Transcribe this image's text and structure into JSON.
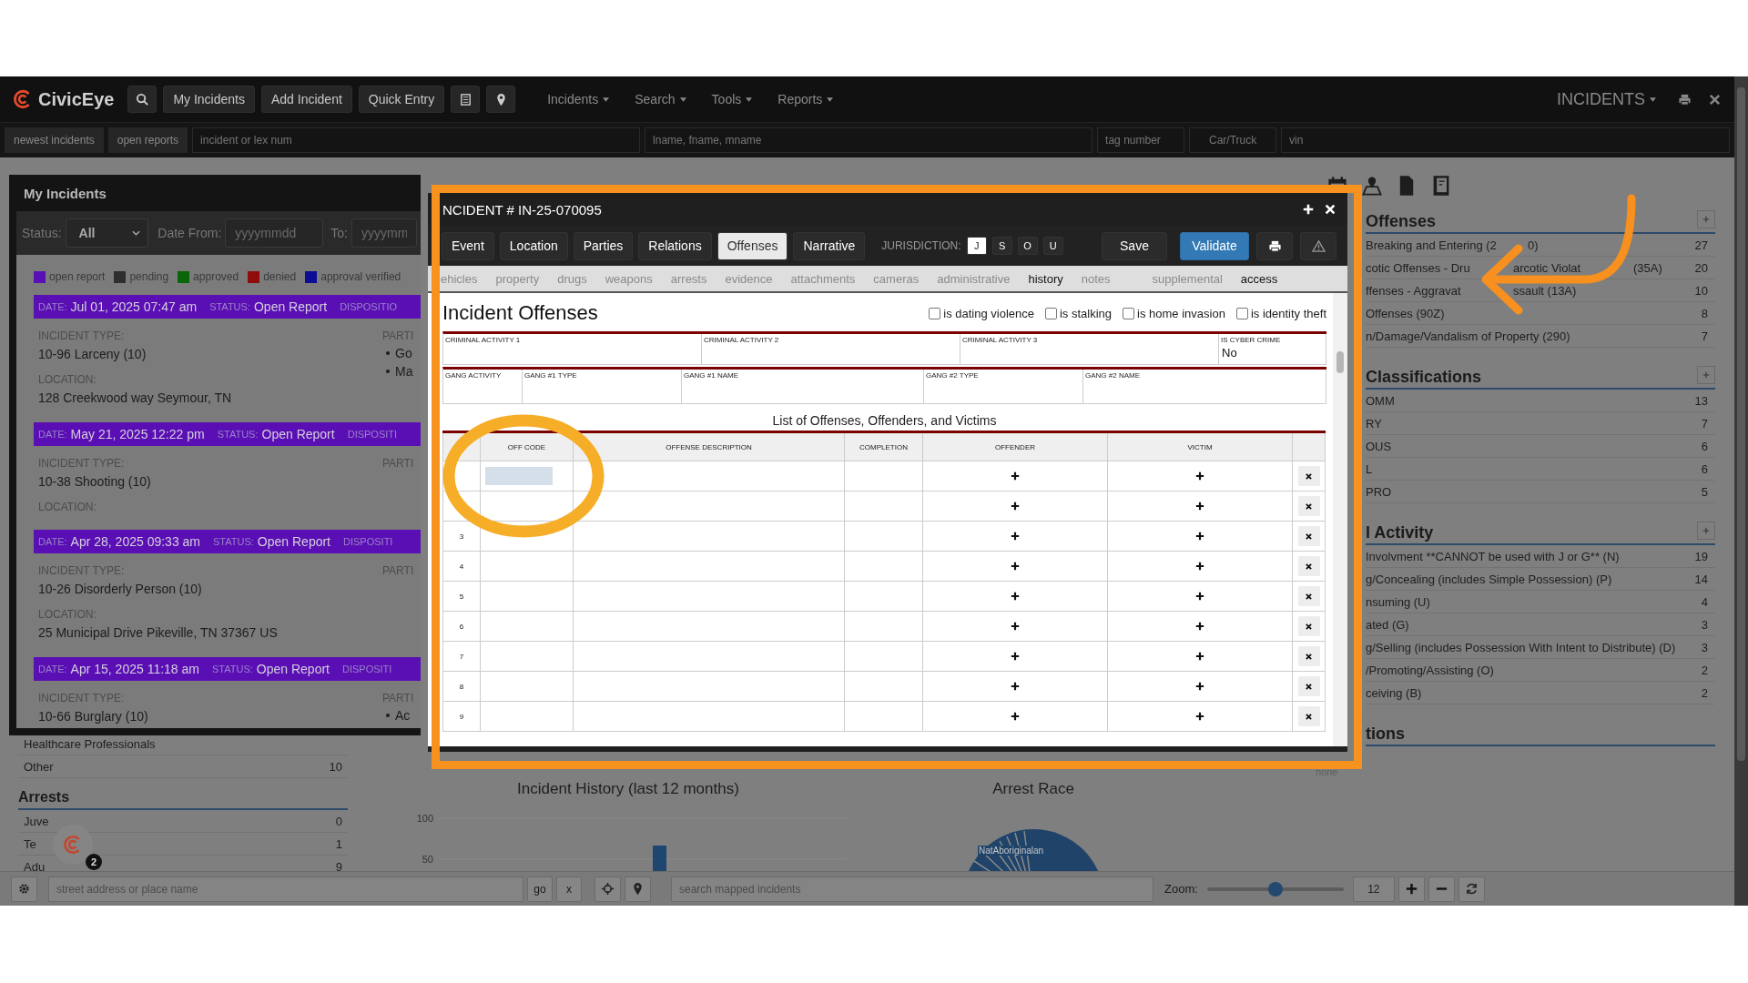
{
  "navbar": {
    "brand": "CivicEye",
    "buttons": [
      "My Incidents",
      "Add Incident",
      "Quick Entry"
    ],
    "menus": [
      "Incidents",
      "Search",
      "Tools",
      "Reports"
    ],
    "module": "INCIDENTS"
  },
  "quick_search": {
    "buttons": [
      "newest incidents",
      "open reports"
    ],
    "fields": [
      {
        "placeholder": "incident or lex num"
      },
      {
        "placeholder": "lname, fname, mname"
      },
      {
        "placeholder": "tag number"
      },
      {
        "placeholder": "Car/Truck"
      },
      {
        "placeholder": "vin"
      }
    ]
  },
  "dashboard": {
    "left_rows": [
      {
        "label": "Healthcare Professionals"
      },
      {
        "label": "Other",
        "count": "10"
      }
    ],
    "arrests": {
      "title": "Arrests",
      "rows": [
        {
          "label": "Juve",
          "count": "0"
        },
        {
          "label": "Te",
          "count": "1"
        },
        {
          "label": "Adu",
          "count": "9"
        }
      ]
    },
    "history_chart": {
      "title": "Incident History (last 12 months)",
      "tick_labels": [
        "100",
        "50"
      ]
    },
    "race_chart": {
      "title": "Arrest Race",
      "label": "NatAboriginalan"
    },
    "right_sections": [
      {
        "title": "Offenses",
        "expandable": true,
        "rows": [
          {
            "parts": [
              "Breaking and Entering (2",
              "0)"
            ],
            "count": "27"
          },
          {
            "parts": [
              "cotic Offenses - Dru",
              "arcotic Violat",
              "(35A)"
            ],
            "count": "20"
          },
          {
            "parts": [
              "ffenses - Aggravat",
              "ssault (13A)"
            ],
            "count": "10"
          },
          {
            "parts": [
              "Offenses (90Z)"
            ],
            "count": "8"
          },
          {
            "parts": [
              "n/Damage/Vandalism of Property (290)"
            ],
            "count": "7"
          }
        ]
      },
      {
        "title": "Classifications",
        "expandable": true,
        "rows": [
          {
            "parts": [
              "OMM"
            ],
            "count": "13"
          },
          {
            "parts": [
              "RY"
            ],
            "count": "7"
          },
          {
            "parts": [
              "OUS"
            ],
            "count": "6"
          },
          {
            "parts": [
              "L"
            ],
            "count": "6"
          },
          {
            "parts": [
              "PRO"
            ],
            "count": "5"
          }
        ]
      },
      {
        "title": "l Activity",
        "expandable": true,
        "rows": [
          {
            "parts": [
              "Involvment **CANNOT be used with J or G** (N)"
            ],
            "count": "19"
          },
          {
            "parts": [
              "g/Concealing (includes Simple Possession) (P)"
            ],
            "count": "14"
          },
          {
            "parts": [
              "nsuming (U)"
            ],
            "count": "4"
          },
          {
            "parts": [
              "ated (G)"
            ],
            "count": "3"
          },
          {
            "parts": [
              "g/Selling (includes Possession With Intent to Distribute) (D)"
            ],
            "count": "3"
          },
          {
            "parts": [
              "/Promoting/Assisting (O)"
            ],
            "count": "2"
          },
          {
            "parts": [
              "ceiving (B)"
            ],
            "count": "2"
          }
        ]
      },
      {
        "title": "tions",
        "expandable": false,
        "empty_text": "none"
      }
    ]
  },
  "my_incidents": {
    "title": "My Incidents",
    "status_label": "Status:",
    "status_value": "All",
    "date_from_label": "Date From:",
    "date_from_placeholder": "yyyymmdd",
    "to_label": "To:",
    "to_placeholder": "yyyymm",
    "legend": [
      {
        "label": "open report",
        "color": "#5a0fb4"
      },
      {
        "label": "pending",
        "color": "#2e2e2e"
      },
      {
        "label": "approved",
        "color": "#0b650b"
      },
      {
        "label": "denied",
        "color": "#8e0c0c"
      },
      {
        "label": "approval verified",
        "color": "#0c0c96"
      }
    ],
    "incidents": [
      {
        "date_label": "DATE:",
        "date": "Jul 01, 2025 07:47 am",
        "status_label": "STATUS:",
        "status": "Open Report",
        "disposition_label": "DISPOSITIO",
        "color": "#5a0fb4",
        "type_label": "INCIDENT TYPE:",
        "type": "10-96 Larceny (10)",
        "parties_label": "PARTI",
        "parties": [
          "Go",
          "Ma"
        ],
        "location_label": "LOCATION:",
        "location": "128 Creekwood way Seymour, TN"
      },
      {
        "date_label": "DATE:",
        "date": "May 21, 2025 12:22 pm",
        "status_label": "STATUS:",
        "status": "Open Report",
        "disposition_label": "DISPOSITI",
        "color": "#5a0fb4",
        "type_label": "INCIDENT TYPE:",
        "type": "10-38 Shooting (10)",
        "parties_label": "PARTI",
        "location_label": "LOCATION:"
      },
      {
        "date_label": "DATE:",
        "date": "Apr 28, 2025 09:33 am",
        "status_label": "STATUS:",
        "status": "Open Report",
        "disposition_label": "DISPOSITI",
        "color": "#5a0fb4",
        "type_label": "INCIDENT TYPE:",
        "type": "10-26 Disorderly Person (10)",
        "parties_label": "PARTI",
        "location_label": "LOCATION:",
        "location": "25 Municipal Drive Pikeville, TN 37367 US"
      },
      {
        "date_label": "DATE:",
        "date": "Apr 15, 2025 11:18 am",
        "status_label": "STATUS:",
        "status": "Open Report",
        "disposition_label": "DISPOSITI",
        "color": "#5a0fb4",
        "type_label": "INCIDENT TYPE:",
        "type": "10-66 Burglary (10)",
        "parties_label": "PARTI",
        "parties": [
          "Ac"
        ]
      }
    ]
  },
  "incident_modal": {
    "title": "NCIDENT # IN-25-070095",
    "tabs": [
      {
        "label": "Event",
        "selected": false
      },
      {
        "label": "Location",
        "selected": false
      },
      {
        "label": "Parties",
        "selected": false
      },
      {
        "label": "Relations",
        "selected": false
      },
      {
        "label": "Offenses",
        "selected": true
      },
      {
        "label": "Narrative",
        "selected": false
      }
    ],
    "jurisdiction_label": "JURISDICTION:",
    "jurisdictions": [
      {
        "label": "J",
        "selected": true
      },
      {
        "label": "S",
        "selected": false
      },
      {
        "label": "O",
        "selected": false
      },
      {
        "label": "U",
        "selected": false
      }
    ],
    "actions": [
      {
        "label": "Save",
        "kind": "default"
      },
      {
        "label": "Validate",
        "kind": "primary"
      }
    ],
    "subnav": [
      {
        "label": "ehicles",
        "highlighted": false
      },
      {
        "label": "property",
        "highlighted": false
      },
      {
        "label": "drugs",
        "highlighted": false
      },
      {
        "label": "weapons",
        "highlighted": false
      },
      {
        "label": "arrests",
        "highlighted": false
      },
      {
        "label": "evidence",
        "highlighted": false
      },
      {
        "label": "attachments",
        "highlighted": false
      },
      {
        "label": "cameras",
        "highlighted": false
      },
      {
        "label": "administrative",
        "highlighted": false
      },
      {
        "label": "history",
        "highlighted": true
      },
      {
        "label": "notes",
        "highlighted": false
      },
      {
        "label": "supplemental",
        "highlighted": false
      },
      {
        "label": "access",
        "highlighted": true
      }
    ],
    "section_title": "Incident Offenses",
    "flags": [
      {
        "label": "is dating violence",
        "checked": false
      },
      {
        "label": "is stalking",
        "checked": false
      },
      {
        "label": "is home invasion",
        "checked": false
      },
      {
        "label": "is identity theft",
        "checked": false
      }
    ],
    "criminal_fields": [
      {
        "label": "CRIMINAL ACTIVITY 1"
      },
      {
        "label": "CRIMINAL ACTIVITY 2"
      },
      {
        "label": "CRIMINAL ACTIVITY 3"
      },
      {
        "label": "IS CYBER CRIME",
        "value": "No"
      }
    ],
    "gang_fields": [
      {
        "label": "GANG ACTIVITY"
      },
      {
        "label": "GANG #1 TYPE"
      },
      {
        "label": "GANG #1 NAME"
      },
      {
        "label": "GANG #2 TYPE"
      },
      {
        "label": "GANG #2 NAME"
      }
    ],
    "table_title": "List of Offenses, Offenders, and Victims",
    "columns": [
      "OFF CODE",
      "OFFENSE DESCRIPTION",
      "COMPLETION",
      "OFFENDER",
      "VICTIM"
    ],
    "rows": [
      {
        "focused": true
      },
      {
        "focused": false
      },
      {
        "number": "3",
        "focused": false
      },
      {
        "number": "4",
        "focused": false
      },
      {
        "number": "5",
        "focused": false
      },
      {
        "number": "6",
        "focused": false
      },
      {
        "number": "7",
        "focused": false
      },
      {
        "number": "8",
        "focused": false
      },
      {
        "number": "9",
        "focused": false
      }
    ]
  },
  "chat_widget": {
    "badge": "2"
  },
  "bottom_bar": {
    "address_placeholder": "street address or place name",
    "go": "go",
    "clear": "x",
    "map_search_placeholder": "search mapped incidents",
    "zoom_label": "Zoom:",
    "zoom": {
      "level": 0.5
    },
    "zoom_value": "12"
  }
}
